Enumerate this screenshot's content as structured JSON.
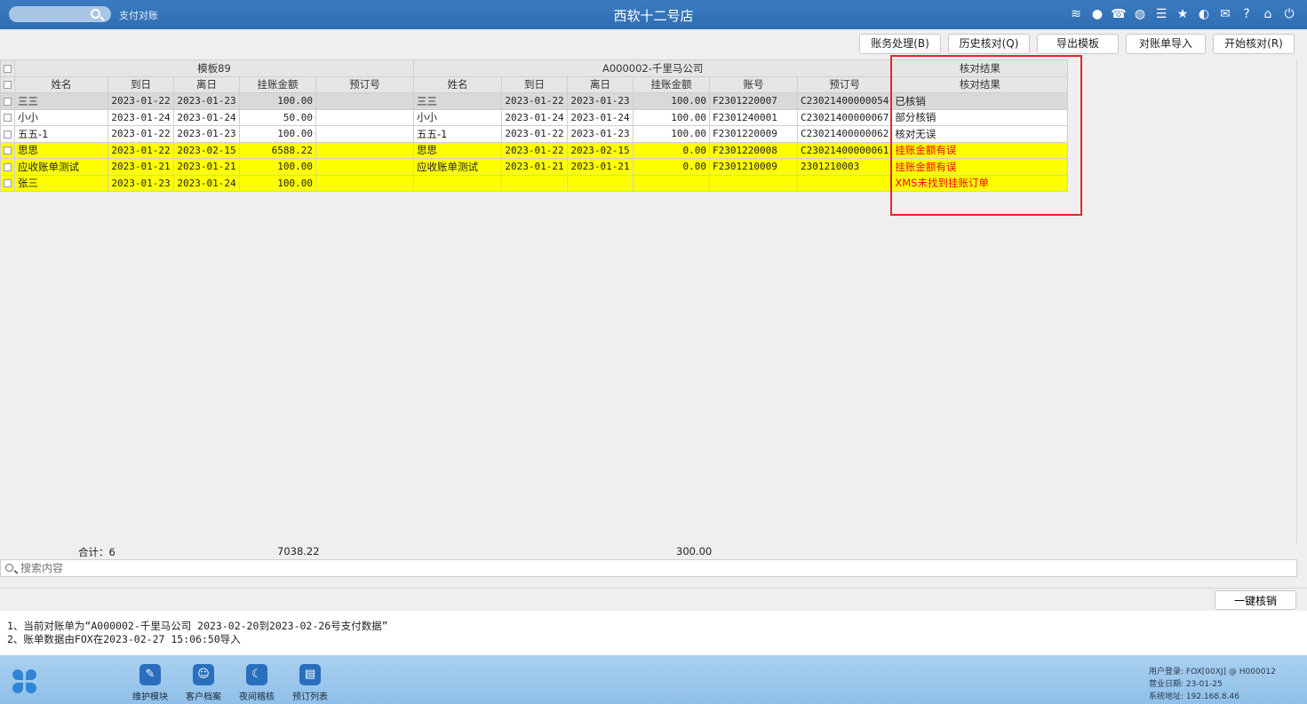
{
  "titlebar": {
    "search_placeholder": "",
    "subtitle": "支付对账",
    "title": "西软十二号店",
    "icons": [
      "wifi-icon",
      "chat-icon",
      "phone-icon",
      "palette-icon",
      "menu-icon",
      "star-icon",
      "theme-icon",
      "mail-icon",
      "help-icon",
      "home-icon",
      "power-icon"
    ]
  },
  "toolbar": {
    "btn1": "账务处理(B)",
    "btn2": "历史核对(Q)",
    "btn3": "导出模板",
    "btn4": "对账单导入",
    "btn5": "开始核对(R)"
  },
  "table": {
    "group_left": "模板89",
    "group_right": "A000002-千里马公司",
    "group_result": "核对结果",
    "headers_left": [
      "姓名",
      "到日",
      "离日",
      "挂账金额",
      "预订号"
    ],
    "headers_right": [
      "姓名",
      "到日",
      "离日",
      "挂账金额",
      "账号",
      "预订号"
    ],
    "header_result": "核对结果",
    "rows": [
      {
        "style": "gray",
        "l_name": "三三",
        "l_arr": "2023-01-22",
        "l_dep": "2023-01-23",
        "l_amt": "100.00",
        "l_resv": "",
        "r_name": "三三",
        "r_arr": "2023-01-22",
        "r_dep": "2023-01-23",
        "r_amt": "100.00",
        "r_acct": "F2301220007",
        "r_resv": "C23021400000054",
        "result": "已核销",
        "red": false
      },
      {
        "style": "white",
        "l_name": "小小",
        "l_arr": "2023-01-24",
        "l_dep": "2023-01-24",
        "l_amt": "50.00",
        "l_resv": "",
        "r_name": "小小",
        "r_arr": "2023-01-24",
        "r_dep": "2023-01-24",
        "r_amt": "100.00",
        "r_acct": "F2301240001",
        "r_resv": "C23021400000067",
        "result": "部分核销",
        "red": false
      },
      {
        "style": "white",
        "l_name": "五五-1",
        "l_arr": "2023-01-22",
        "l_dep": "2023-01-23",
        "l_amt": "100.00",
        "l_resv": "",
        "r_name": "五五-1",
        "r_arr": "2023-01-22",
        "r_dep": "2023-01-23",
        "r_amt": "100.00",
        "r_acct": "F2301220009",
        "r_resv": "C23021400000062",
        "result": "核对无误",
        "red": false
      },
      {
        "style": "yellow",
        "l_name": "思思",
        "l_arr": "2023-01-22",
        "l_dep": "2023-02-15",
        "l_amt": "6588.22",
        "l_resv": "",
        "r_name": "思思",
        "r_arr": "2023-01-22",
        "r_dep": "2023-02-15",
        "r_amt": "0.00",
        "r_acct": "F2301220008",
        "r_resv": "C23021400000061",
        "result": "挂账金额有误",
        "red": true
      },
      {
        "style": "yellow",
        "l_name": "应收账单测试",
        "l_arr": "2023-01-21",
        "l_dep": "2023-01-21",
        "l_amt": "100.00",
        "l_resv": "",
        "r_name": "应收账单测试",
        "r_arr": "2023-01-21",
        "r_dep": "2023-01-21",
        "r_amt": "0.00",
        "r_acct": "F2301210009",
        "r_resv": "2301210003",
        "result": "挂账金额有误",
        "red": true
      },
      {
        "style": "yellow",
        "l_name": "张三",
        "l_arr": "2023-01-23",
        "l_dep": "2023-01-24",
        "l_amt": "100.00",
        "l_resv": "",
        "r_name": "",
        "r_arr": "",
        "r_dep": "",
        "r_amt": "",
        "r_acct": "",
        "r_resv": "",
        "result": "XMS未找到挂账订单",
        "red": true
      }
    ]
  },
  "totals": {
    "count_label": "合计：6",
    "left_total": "7038.22",
    "right_total": "300.00"
  },
  "search": {
    "placeholder": "搜索内容"
  },
  "one_key_button": "一键核销",
  "notes": {
    "line1": "1、当前对账单为“A000002-千里马公司 2023-02-20到2023-02-26号支付数据”",
    "line2": "2、账单数据由FOX在2023-02-27 15:06:50导入"
  },
  "dock": {
    "items": [
      "维护模块",
      "客户档案",
      "夜间稽核",
      "预订列表"
    ],
    "status_user": "用户登录: FOX[00XJ] @ H000012",
    "status_date": "营业日期: 23-01-25",
    "status_addr": "系统地址: 192.168.8.46"
  }
}
